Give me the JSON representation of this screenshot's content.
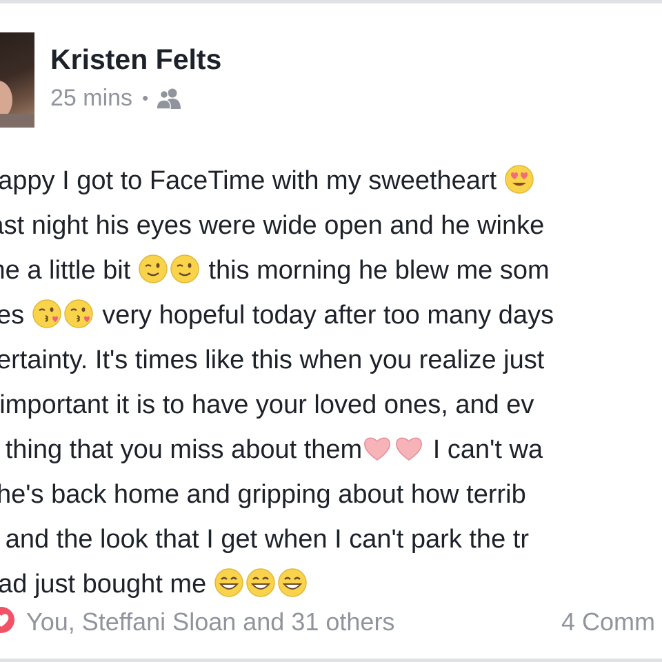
{
  "post": {
    "author": "Kristen Felts",
    "time": "25 mins",
    "separator": "•",
    "audience_icon": "friends-icon",
    "lines": [
      {
        "before": "happy I got to FaceTime with my sweetheart ",
        "emojis": [
          "heart-eyes"
        ],
        "after": ""
      },
      {
        "before": "last night his eyes were wide open and he winke",
        "emojis": [],
        "after": ""
      },
      {
        "before": "me a little bit ",
        "emojis": [
          "wink",
          "wink"
        ],
        "after": " this morning he blew me som"
      },
      {
        "before": "ses ",
        "emojis": [
          "kiss",
          "kiss"
        ],
        "after": " very hopeful today after too many days"
      },
      {
        "before": "certainty. It's times like this when you realize just",
        "emojis": [],
        "after": ""
      },
      {
        "before": "r important it is to have your loved ones, and ev",
        "emojis": [],
        "after": ""
      },
      {
        "before": "e thing that you miss about them",
        "emojis": [
          "pink-heart",
          "pink-heart"
        ],
        "after": " I can't wa"
      },
      {
        "before": "l he's back home and gripping about how terrib",
        "emojis": [],
        "after": ""
      },
      {
        "before": "e and the look that I get when I can't park the tr",
        "emojis": [],
        "after": ""
      },
      {
        "before": "had just bought me ",
        "emojis": [
          "grin",
          "grin",
          "grin"
        ],
        "after": ""
      }
    ]
  },
  "footer": {
    "reaction_icon": "love-reaction-icon",
    "reaction_color": "#f25268",
    "likers": "You, Steffani Sloan and 31 others",
    "comments": "4 Comm"
  }
}
